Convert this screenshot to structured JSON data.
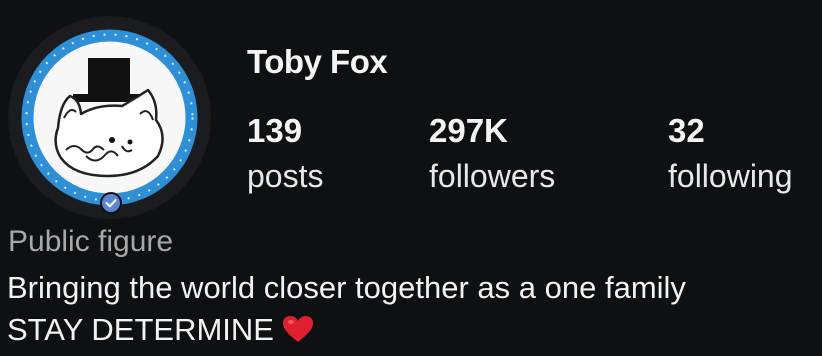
{
  "profile": {
    "name": "Toby Fox",
    "stats": {
      "posts": {
        "count": "139",
        "label": "posts"
      },
      "followers": {
        "count": "297K",
        "label": "followers"
      },
      "following": {
        "count": "32",
        "label": "following"
      }
    },
    "category": "Public figure",
    "bio": {
      "line1": "Bringing the world closer together as a one family",
      "line2": "STAY DETERMINE"
    },
    "verified": true
  },
  "colors": {
    "background": "#0f1012",
    "avatar_ring": "#2f8fd6",
    "verified_badge": "#5b86d6",
    "heart": "#e0202e",
    "muted_text": "#a8a8a8"
  },
  "icons": {
    "avatar": "dog-with-top-hat-drawing",
    "verified": "check-badge-icon",
    "heart": "red-heart-emoji"
  }
}
